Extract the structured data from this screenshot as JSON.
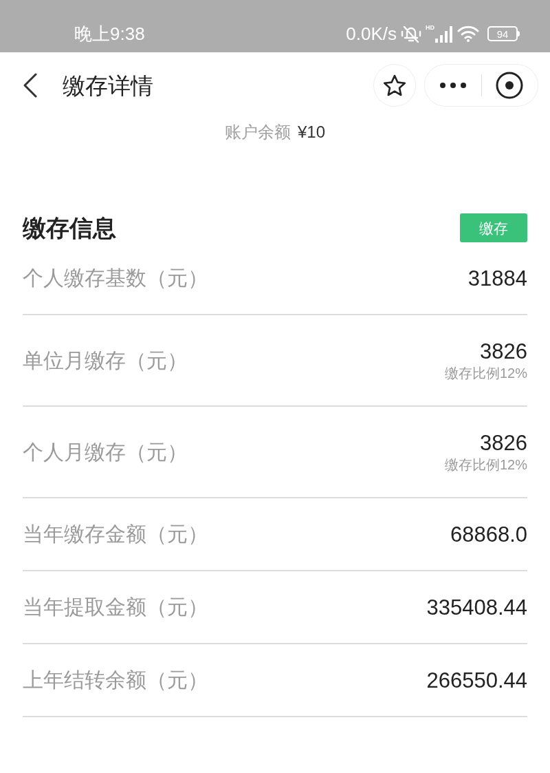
{
  "status_bar": {
    "time": "晚上9:38",
    "network_speed": "0.0K/s",
    "signal_label": "HD",
    "battery": "94"
  },
  "nav_bar": {
    "title": "缴存详情"
  },
  "account_balance": {
    "label": "账户余额",
    "value": "¥10"
  },
  "section": {
    "title": "缴存信息",
    "action_button": "缴存"
  },
  "rows": [
    {
      "label": "个人缴存基数（元）",
      "value": "31884"
    },
    {
      "label": "单位月缴存（元）",
      "value": "3826",
      "note": "缴存比例12%"
    },
    {
      "label": "个人月缴存（元）",
      "value": "3826",
      "note": "缴存比例12%"
    },
    {
      "label": "当年缴存金额（元）",
      "value": "68868.0"
    },
    {
      "label": "当年提取金额（元）",
      "value": "335408.44"
    },
    {
      "label": "上年结转余额（元）",
      "value": "266550.44"
    }
  ]
}
